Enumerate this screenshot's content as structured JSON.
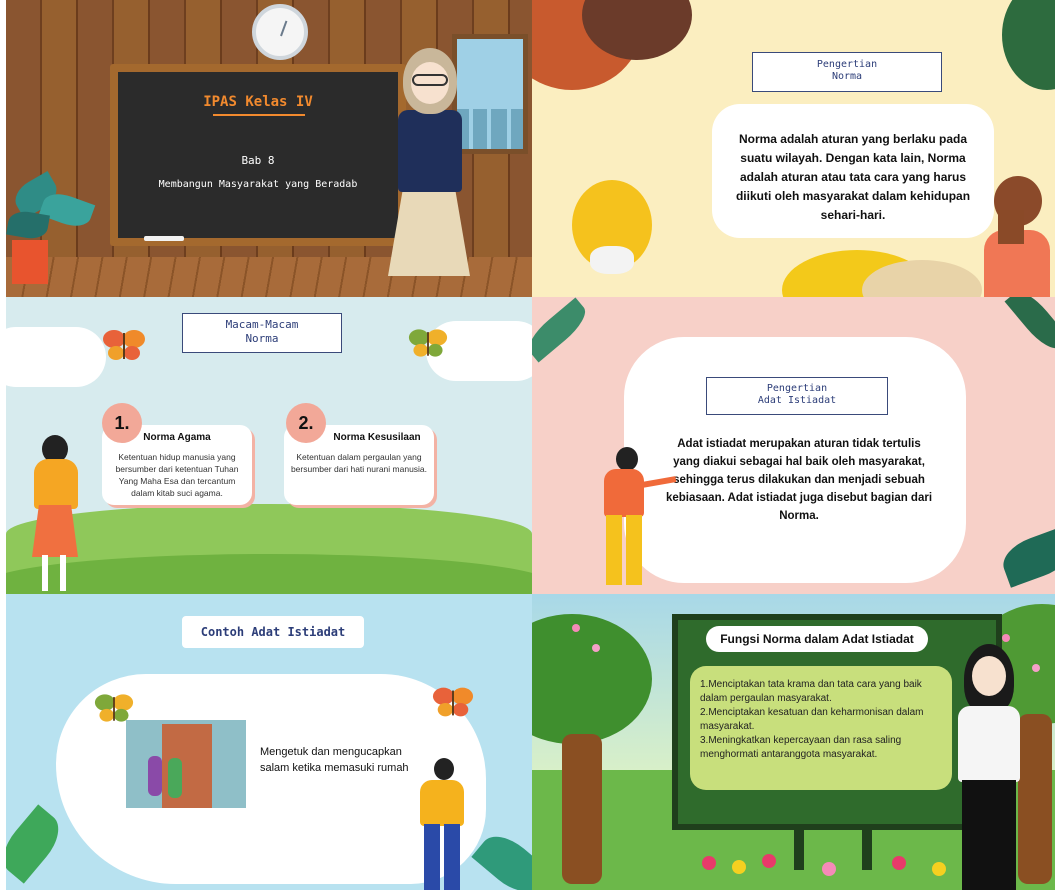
{
  "slide1": {
    "title": "IPAS Kelas IV",
    "bab": "Bab 8",
    "subtitle": "Membangun Masyarakat yang Beradab"
  },
  "slide2": {
    "label_line1": "Pengertian",
    "label_line2": "Norma",
    "body": "Norma adalah aturan yang berlaku pada suatu wilayah. Dengan kata lain, Norma adalah aturan atau tata cara yang harus diikuti oleh masyarakat dalam kehidupan sehari-hari."
  },
  "slide3": {
    "label_line1": "Macam-Macam",
    "label_line2": "Norma",
    "items": [
      {
        "number": "1.",
        "title": "Norma Agama",
        "desc": "Ketentuan hidup manusia yang bersumber dari ketentuan Tuhan Yang Maha Esa dan tercantum dalam kitab suci agama."
      },
      {
        "number": "2.",
        "title": "Norma Kesusilaan",
        "desc": "Ketentuan dalam pergaulan yang bersumber dari hati nurani manusia."
      }
    ]
  },
  "slide4": {
    "label_line1": "Pengertian",
    "label_line2": "Adat Istiadat",
    "body": "Adat istiadat merupakan aturan tidak tertulis yang diakui sebagai hal baik oleh masyarakat, sehingga terus dilakukan dan menjadi sebuah kebiasaan. Adat istiadat juga disebut bagian dari Norma."
  },
  "slide5": {
    "label": "Contoh Adat Istiadat",
    "example_line1": "Mengetuk dan mengucapkan",
    "example_line2": "salam ketika memasuki rumah"
  },
  "slide6": {
    "title": "Fungsi Norma dalam Adat Istiadat",
    "items": [
      "1.Menciptakan tata krama dan tata cara yang baik dalam pergaulan masyarakat.",
      "2.Menciptakan kesatuan dan keharmonisan dalam masyarakat.",
      "3.Meningkatkan kepercayaan dan rasa saling menghormati antaranggota masyarakat."
    ]
  },
  "colors": {
    "accent_orange": "#f28a2e",
    "label_blue": "#2c3d78",
    "salmon": "#f2a898",
    "list_green": "#c8df7c"
  }
}
